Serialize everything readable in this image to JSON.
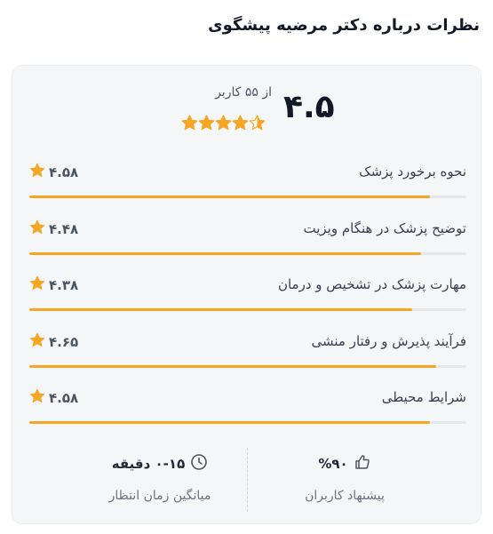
{
  "title": "نظرات درباره دکتر مرضیه پیشگوی",
  "summary": {
    "score": "۴.۵",
    "users_text": "از ۵۵ کاربر",
    "rating": 4.5,
    "max": 5
  },
  "criteria": [
    {
      "label": "نحوه برخورد پزشک",
      "score_text": "۴.۵۸",
      "value": 4.58
    },
    {
      "label": "توضیح پزشک در هنگام ویزیت",
      "score_text": "۴.۴۸",
      "value": 4.48
    },
    {
      "label": "مهارت پزشک در تشخیص و درمان",
      "score_text": "۴.۳۸",
      "value": 4.38
    },
    {
      "label": "فرآیند پذیرش و رفتار منشی",
      "score_text": "۴.۶۵",
      "value": 4.65
    },
    {
      "label": "شرایط محیطی",
      "score_text": "۴.۵۸",
      "value": 4.58
    }
  ],
  "stats": {
    "wait_time": {
      "value": "۰-۱۵ دقیقه",
      "label": "میانگین زمان انتظار",
      "icon": "clock-icon"
    },
    "recommend": {
      "value": "%۹۰",
      "label": "پیشنهاد کاربران",
      "icon": "thumbs-up-icon"
    }
  },
  "colors": {
    "star": "#F5A623",
    "bar": "#F5A623",
    "track": "#E5E7EB"
  }
}
